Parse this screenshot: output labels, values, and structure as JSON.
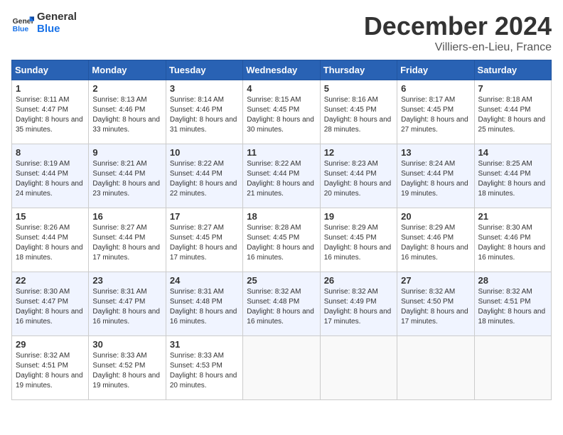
{
  "header": {
    "logo_line1": "General",
    "logo_line2": "Blue",
    "month": "December 2024",
    "location": "Villiers-en-Lieu, France"
  },
  "days_of_week": [
    "Sunday",
    "Monday",
    "Tuesday",
    "Wednesday",
    "Thursday",
    "Friday",
    "Saturday"
  ],
  "weeks": [
    [
      {
        "day": "1",
        "sunrise": "8:11 AM",
        "sunset": "4:47 PM",
        "daylight": "8 hours and 35 minutes."
      },
      {
        "day": "2",
        "sunrise": "8:13 AM",
        "sunset": "4:46 PM",
        "daylight": "8 hours and 33 minutes."
      },
      {
        "day": "3",
        "sunrise": "8:14 AM",
        "sunset": "4:46 PM",
        "daylight": "8 hours and 31 minutes."
      },
      {
        "day": "4",
        "sunrise": "8:15 AM",
        "sunset": "4:45 PM",
        "daylight": "8 hours and 30 minutes."
      },
      {
        "day": "5",
        "sunrise": "8:16 AM",
        "sunset": "4:45 PM",
        "daylight": "8 hours and 28 minutes."
      },
      {
        "day": "6",
        "sunrise": "8:17 AM",
        "sunset": "4:45 PM",
        "daylight": "8 hours and 27 minutes."
      },
      {
        "day": "7",
        "sunrise": "8:18 AM",
        "sunset": "4:44 PM",
        "daylight": "8 hours and 25 minutes."
      }
    ],
    [
      {
        "day": "8",
        "sunrise": "8:19 AM",
        "sunset": "4:44 PM",
        "daylight": "8 hours and 24 minutes."
      },
      {
        "day": "9",
        "sunrise": "8:21 AM",
        "sunset": "4:44 PM",
        "daylight": "8 hours and 23 minutes."
      },
      {
        "day": "10",
        "sunrise": "8:22 AM",
        "sunset": "4:44 PM",
        "daylight": "8 hours and 22 minutes."
      },
      {
        "day": "11",
        "sunrise": "8:22 AM",
        "sunset": "4:44 PM",
        "daylight": "8 hours and 21 minutes."
      },
      {
        "day": "12",
        "sunrise": "8:23 AM",
        "sunset": "4:44 PM",
        "daylight": "8 hours and 20 minutes."
      },
      {
        "day": "13",
        "sunrise": "8:24 AM",
        "sunset": "4:44 PM",
        "daylight": "8 hours and 19 minutes."
      },
      {
        "day": "14",
        "sunrise": "8:25 AM",
        "sunset": "4:44 PM",
        "daylight": "8 hours and 18 minutes."
      }
    ],
    [
      {
        "day": "15",
        "sunrise": "8:26 AM",
        "sunset": "4:44 PM",
        "daylight": "8 hours and 18 minutes."
      },
      {
        "day": "16",
        "sunrise": "8:27 AM",
        "sunset": "4:44 PM",
        "daylight": "8 hours and 17 minutes."
      },
      {
        "day": "17",
        "sunrise": "8:27 AM",
        "sunset": "4:45 PM",
        "daylight": "8 hours and 17 minutes."
      },
      {
        "day": "18",
        "sunrise": "8:28 AM",
        "sunset": "4:45 PM",
        "daylight": "8 hours and 16 minutes."
      },
      {
        "day": "19",
        "sunrise": "8:29 AM",
        "sunset": "4:45 PM",
        "daylight": "8 hours and 16 minutes."
      },
      {
        "day": "20",
        "sunrise": "8:29 AM",
        "sunset": "4:46 PM",
        "daylight": "8 hours and 16 minutes."
      },
      {
        "day": "21",
        "sunrise": "8:30 AM",
        "sunset": "4:46 PM",
        "daylight": "8 hours and 16 minutes."
      }
    ],
    [
      {
        "day": "22",
        "sunrise": "8:30 AM",
        "sunset": "4:47 PM",
        "daylight": "8 hours and 16 minutes."
      },
      {
        "day": "23",
        "sunrise": "8:31 AM",
        "sunset": "4:47 PM",
        "daylight": "8 hours and 16 minutes."
      },
      {
        "day": "24",
        "sunrise": "8:31 AM",
        "sunset": "4:48 PM",
        "daylight": "8 hours and 16 minutes."
      },
      {
        "day": "25",
        "sunrise": "8:32 AM",
        "sunset": "4:48 PM",
        "daylight": "8 hours and 16 minutes."
      },
      {
        "day": "26",
        "sunrise": "8:32 AM",
        "sunset": "4:49 PM",
        "daylight": "8 hours and 17 minutes."
      },
      {
        "day": "27",
        "sunrise": "8:32 AM",
        "sunset": "4:50 PM",
        "daylight": "8 hours and 17 minutes."
      },
      {
        "day": "28",
        "sunrise": "8:32 AM",
        "sunset": "4:51 PM",
        "daylight": "8 hours and 18 minutes."
      }
    ],
    [
      {
        "day": "29",
        "sunrise": "8:32 AM",
        "sunset": "4:51 PM",
        "daylight": "8 hours and 19 minutes."
      },
      {
        "day": "30",
        "sunrise": "8:33 AM",
        "sunset": "4:52 PM",
        "daylight": "8 hours and 19 minutes."
      },
      {
        "day": "31",
        "sunrise": "8:33 AM",
        "sunset": "4:53 PM",
        "daylight": "8 hours and 20 minutes."
      },
      null,
      null,
      null,
      null
    ]
  ]
}
